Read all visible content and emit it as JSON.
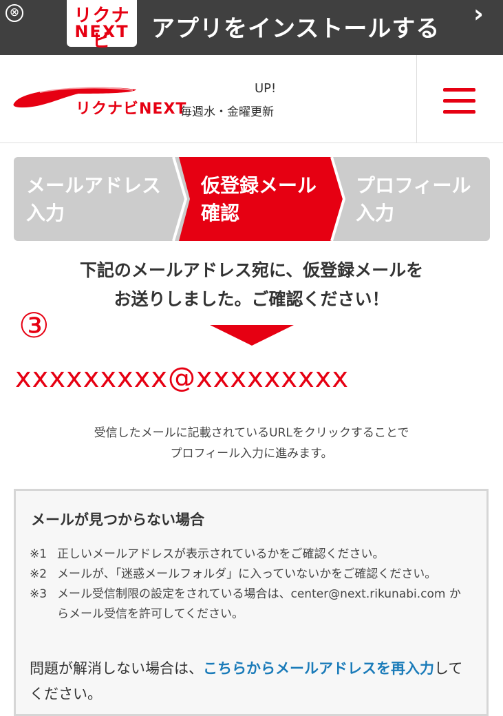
{
  "banner": {
    "close_glyph": "⊗",
    "logo_line1": "リクナビ",
    "logo_line2": "NEXT",
    "text": "アプリをインストールする",
    "chevron_glyph": "›"
  },
  "header": {
    "logo_text": "リクナビNEXT",
    "up_text": "UP!",
    "update_text": "毎週水・金曜更新",
    "menu_icon": "hamburger-icon"
  },
  "steps": [
    {
      "label": "メールアドレス\n入力",
      "active": false
    },
    {
      "label": "仮登録メール\n確認",
      "active": true
    },
    {
      "label": "プロフィール\n入力",
      "active": false
    }
  ],
  "message": {
    "line1": "下記のメールアドレス宛に、仮登録メールを",
    "line2": "お送りしました。ご確認ください！"
  },
  "annotation_number": "③",
  "email": "xxxxxxxxx@xxxxxxxxx",
  "instructions": {
    "line1": "受信したメールに記載されているURLをクリックすることで",
    "line2": "プロフィール入力に進みます。"
  },
  "help": {
    "title": "メールが見つからない場合",
    "items": [
      {
        "mark": "※1",
        "text": "正しいメールアドレスが表示されているかをご確認ください。"
      },
      {
        "mark": "※2",
        "text": "メールが、「迷惑メールフォルダ」に入っていないかをご確認ください。"
      },
      {
        "mark": "※3",
        "text": "メール受信制限の設定をされている場合は、center@next.rikunabi.com からメール受信を許可してください。"
      }
    ],
    "footer_prefix": "問題が解消しない場合は、",
    "footer_link": "こちらからメールアドレスを再入力",
    "footer_suffix": "してください。"
  },
  "colors": {
    "brand_red": "#e60012",
    "step_inactive": "#cccccc",
    "banner_bg": "#404040",
    "link_blue": "#1a7bb9"
  }
}
